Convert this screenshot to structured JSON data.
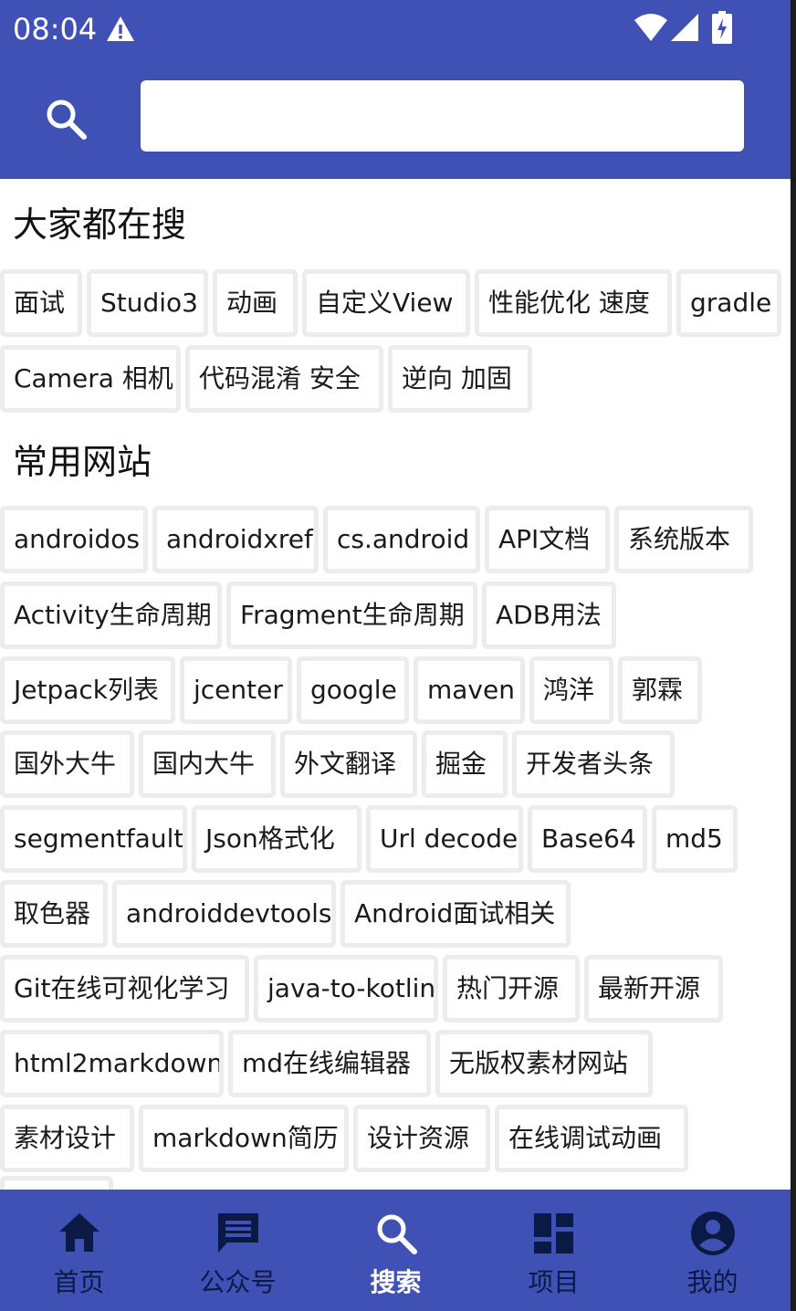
{
  "status_bar": {
    "time": "08:04",
    "warning_icon": "warning-triangle-icon",
    "wifi_icon": "wifi-icon",
    "signal_icon": "cell-signal-icon",
    "battery_icon": "battery-charging-icon"
  },
  "header": {
    "search_icon": "search-icon",
    "search_value": "",
    "search_placeholder": ""
  },
  "hot_section": {
    "title": "大家都在搜",
    "tags": [
      "面试",
      "Studio3",
      "动画",
      "自定义View",
      "性能优化 速度",
      "gradle",
      "Camera 相机",
      "代码混淆 安全",
      "逆向 加固"
    ]
  },
  "sites_section": {
    "title": "常用网站",
    "tags": [
      "androidos",
      "androidxref",
      "cs.android",
      "API文档",
      "系统版本",
      "Activity生命周期",
      "Fragment生命周期",
      "ADB用法",
      "Jetpack列表",
      "jcenter",
      "google",
      "maven",
      "鸿洋",
      "郭霖",
      "国外大牛",
      "国内大牛",
      "外文翻译",
      "掘金",
      "开发者头条",
      "segmentfault",
      "Json格式化",
      "Url decode",
      "Base64",
      "md5",
      "取色器",
      "androiddevtools",
      "Android面试相关",
      "Git在线可视化学习",
      "java-to-kotlin",
      "热门开源",
      "最新开源",
      "html2markdown",
      "md在线编辑器",
      "无版权素材网站",
      "素材设计",
      "markdown简历",
      "设计资源",
      "在线调试动画"
    ]
  },
  "bottom_nav": {
    "items": [
      {
        "label": "首页",
        "icon": "home-icon",
        "active": false
      },
      {
        "label": "公众号",
        "icon": "chat-icon",
        "active": false
      },
      {
        "label": "搜索",
        "icon": "search-icon",
        "active": true
      },
      {
        "label": "项目",
        "icon": "dashboard-icon",
        "active": false
      },
      {
        "label": "我的",
        "icon": "account-icon",
        "active": false
      }
    ]
  },
  "colors": {
    "primary": "#3f51b5",
    "nav_inactive": "#0b1a44",
    "nav_active": "#ffffff",
    "tag_border": "#ececec"
  }
}
